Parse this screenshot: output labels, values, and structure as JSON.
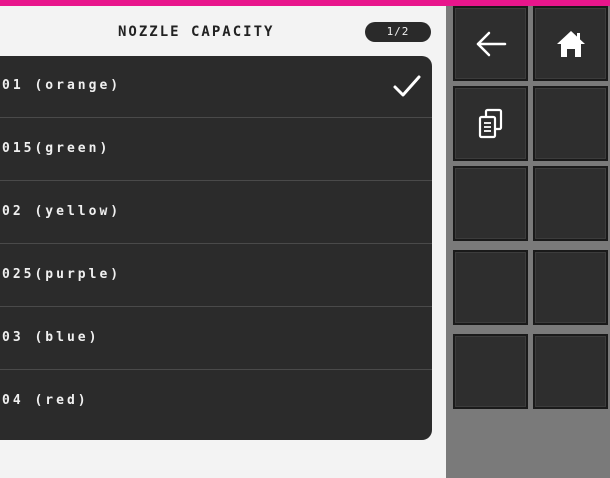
{
  "header": {
    "title": "NOZZLE CAPACITY",
    "page": "1/2"
  },
  "nozzles": {
    "items": [
      {
        "label": "01 (orange)",
        "selected": true
      },
      {
        "label": "015(green)",
        "selected": false
      },
      {
        "label": "02 (yellow)",
        "selected": false
      },
      {
        "label": "025(purple)",
        "selected": false
      },
      {
        "label": "03 (blue)",
        "selected": false
      },
      {
        "label": "04 (red)",
        "selected": false
      }
    ]
  },
  "sidebar": {
    "buttons": [
      {
        "name": "back-button",
        "icon": "arrow-left-icon"
      },
      {
        "name": "home-button",
        "icon": "home-icon"
      },
      {
        "name": "copy-button",
        "icon": "copy-icon"
      },
      {
        "name": "empty-button-4",
        "icon": ""
      },
      {
        "name": "empty-button-5",
        "icon": ""
      },
      {
        "name": "empty-button-6",
        "icon": ""
      },
      {
        "name": "empty-button-7",
        "icon": ""
      },
      {
        "name": "empty-button-8",
        "icon": ""
      },
      {
        "name": "empty-button-9",
        "icon": ""
      },
      {
        "name": "empty-button-10",
        "icon": ""
      }
    ]
  },
  "colors": {
    "accent": "#e8168c",
    "panel": "#2b2b2b",
    "button": "#2e2e2e"
  }
}
